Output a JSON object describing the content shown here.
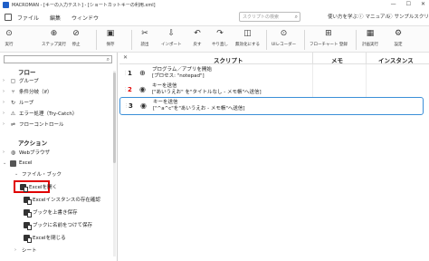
{
  "titlebar": {
    "title": "MACROMAN - [キーの入力テスト] - [ショートカットキーの利用.xml]",
    "minimize": "—",
    "maximize": "☐",
    "close": "✕"
  },
  "menu": {
    "items": [
      "ファイル",
      "編集",
      "ウィンドウ"
    ],
    "search_placeholder": "スクリプトの検索",
    "qa_label": "使い方を学ぶ",
    "manual_label": "マニュアル",
    "sample_label": "サンプルスクリプト"
  },
  "toolbar": {
    "run": "実行",
    "step_run": "ステップ実行",
    "stop": "停止",
    "save": "保存",
    "cut_file": "読出",
    "import": "インポート",
    "undo": "戻す",
    "redo": "やり直し",
    "breakpoint": "無効化にする",
    "ui_recorder": "UIレコーダー",
    "flowchart": "フローチャート 登録",
    "schedule": "計画実行",
    "settings": "設定"
  },
  "sidebar": {
    "flow_heading": "フロー",
    "flow_items": [
      "グループ",
      "条件分岐（if）",
      "ループ",
      "エラー処理（Try-Catch）",
      "フローコントロール"
    ],
    "action_heading": "アクション",
    "action_items": [
      "Webブラウザ",
      "Excel"
    ],
    "excel_group": "ファイル・ブック",
    "excel_items": [
      "Excelを開く",
      "Excelインスタンスの存在確認",
      "ブックを上書き保存",
      "ブックに名前をつけて保存",
      "Excelを閉じる"
    ],
    "sheet_group": "シート"
  },
  "main": {
    "columns": {
      "script": "スクリプト",
      "memo": "メモ",
      "instance": "インスタンス"
    },
    "steps": [
      {
        "num": "1",
        "line1": "プログラム／アプリを開始",
        "line2": "[プロセス: \"notepad\"]"
      },
      {
        "num": "2",
        "line1": "キーを送信",
        "line2": "[\"あいうえお\" を\"タイトルなし - メモ帳\"へ送信]"
      },
      {
        "num": "3",
        "line1": "キーを送信",
        "line2": "[\"^a^c\"を\"あいうえお - メモ帳\"へ送信]"
      }
    ]
  },
  "colors": {
    "accent": "#1e5fc8",
    "highlight": "#e00000",
    "selection": "#3b8fd8"
  }
}
